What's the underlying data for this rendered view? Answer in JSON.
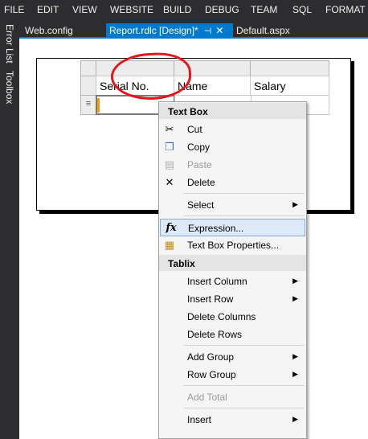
{
  "menubar": {
    "items": [
      "FILE",
      "EDIT",
      "VIEW",
      "WEBSITE",
      "BUILD",
      "DEBUG",
      "TEAM",
      "SQL",
      "FORMAT"
    ]
  },
  "sidebar": {
    "error_list": "Error List",
    "toolbox": "Toolbox"
  },
  "tabs": {
    "web_config": "Web.config",
    "report": "Report.rdlc [Design]*",
    "default_aspx": "Default.aspx"
  },
  "tablix": {
    "headers": [
      "Serial No.",
      "Name",
      "Salary"
    ],
    "row_handle_icon": "≡"
  },
  "context_menu": {
    "text_box_header": "Text Box",
    "cut": "Cut",
    "copy": "Copy",
    "paste": "Paste",
    "delete": "Delete",
    "select": "Select",
    "expression": "Expression...",
    "text_box_properties": "Text Box Properties...",
    "tablix_header": "Tablix",
    "insert_column": "Insert Column",
    "insert_row": "Insert Row",
    "delete_columns": "Delete Columns",
    "delete_rows": "Delete Rows",
    "add_group": "Add Group",
    "row_group": "Row Group",
    "add_total": "Add Total",
    "insert": "Insert"
  },
  "colors": {
    "accent": "#007acc",
    "annotation": "#e8141c"
  }
}
